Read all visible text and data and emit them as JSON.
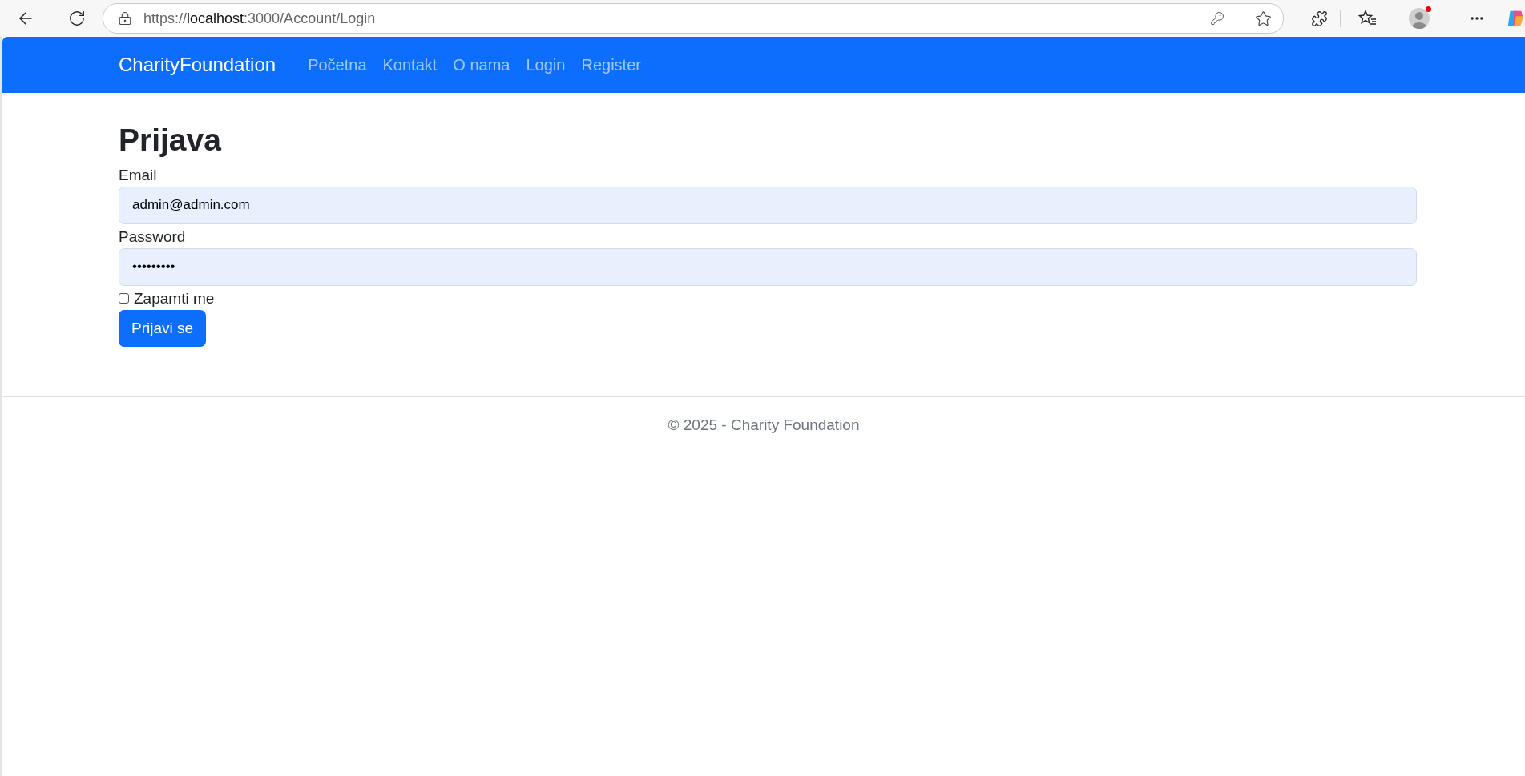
{
  "browser": {
    "address": {
      "scheme": "https://",
      "host": "localhost",
      "rest": ":3000/Account/Login"
    },
    "profile_notification": true
  },
  "navbar": {
    "brand": "CharityFoundation",
    "links": [
      {
        "label": "Početna"
      },
      {
        "label": "Kontakt"
      },
      {
        "label": "O nama"
      },
      {
        "label": "Login"
      },
      {
        "label": "Register"
      }
    ]
  },
  "form": {
    "title": "Prijava",
    "fields": [
      {
        "label": "Email",
        "value": "admin@admin.com"
      },
      {
        "label": "Password",
        "value": "•••••••••"
      }
    ],
    "remember": {
      "label": "Zapamti me",
      "checked": false
    },
    "submit": "Prijavi se"
  },
  "footer": {
    "text": "© 2025 - Charity Foundation"
  }
}
